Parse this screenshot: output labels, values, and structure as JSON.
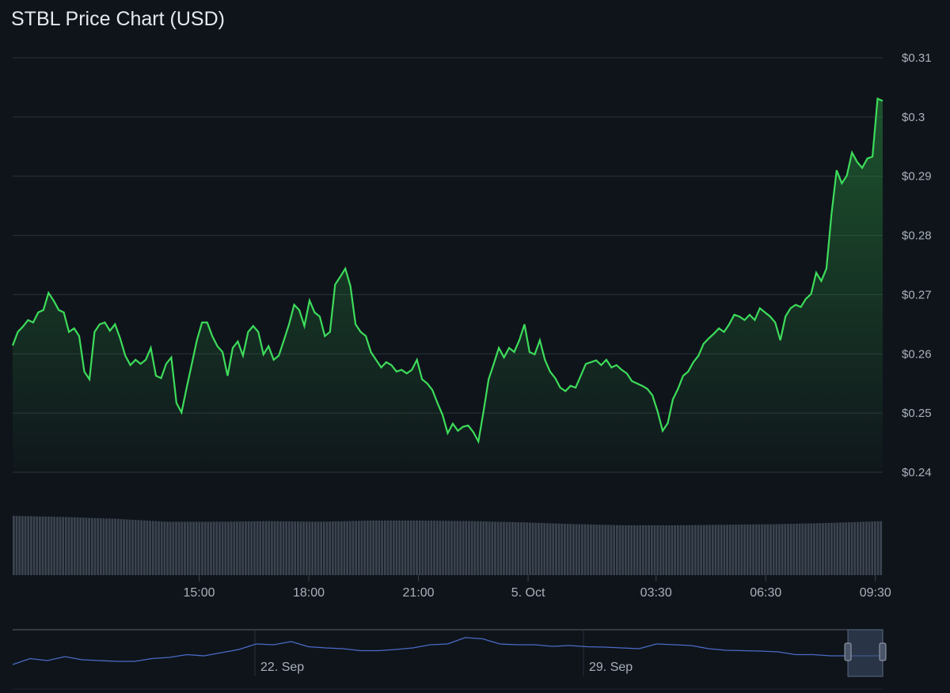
{
  "chart_data": {
    "type": "line",
    "title": "STBL Price Chart (USD)",
    "xlabel": "",
    "ylabel": "",
    "ylim": [
      0.24,
      0.31
    ],
    "y_ticks": [
      "$0.31",
      "$0.3",
      "$0.29",
      "$0.28",
      "$0.27",
      "$0.26",
      "$0.25",
      "$0.24"
    ],
    "y_tick_values": [
      0.31,
      0.3,
      0.29,
      0.28,
      0.27,
      0.26,
      0.25,
      0.24
    ],
    "x_ticks": [
      "15:00",
      "18:00",
      "21:00",
      "5. Oct",
      "03:30",
      "06:30",
      "09:30"
    ],
    "x_tick_hours": [
      15,
      18,
      21,
      24,
      27.5,
      30.5,
      33.5
    ],
    "x_range_hours": [
      9.9,
      33.7
    ],
    "grid": true,
    "series": [
      {
        "name": "STBL price",
        "color": "#3ddc5a",
        "values": [
          0.2614,
          0.2637,
          0.2646,
          0.2657,
          0.2653,
          0.267,
          0.2674,
          0.2703,
          0.269,
          0.2674,
          0.267,
          0.2637,
          0.2643,
          0.263,
          0.257,
          0.2557,
          0.2637,
          0.265,
          0.2653,
          0.2639,
          0.265,
          0.2626,
          0.2597,
          0.2581,
          0.259,
          0.2583,
          0.259,
          0.261,
          0.2563,
          0.2559,
          0.2583,
          0.2594,
          0.2517,
          0.2501,
          0.2543,
          0.2583,
          0.2623,
          0.2653,
          0.2653,
          0.263,
          0.2613,
          0.2603,
          0.2563,
          0.261,
          0.2621,
          0.2597,
          0.2637,
          0.2647,
          0.2637,
          0.2599,
          0.2613,
          0.259,
          0.2597,
          0.2623,
          0.265,
          0.2683,
          0.2674,
          0.2647,
          0.269,
          0.267,
          0.2663,
          0.263,
          0.2637,
          0.2717,
          0.273,
          0.2744,
          0.2714,
          0.265,
          0.2637,
          0.263,
          0.2603,
          0.259,
          0.2577,
          0.2586,
          0.2581,
          0.257,
          0.2573,
          0.2567,
          0.2573,
          0.259,
          0.2557,
          0.255,
          0.2539,
          0.2517,
          0.2497,
          0.2466,
          0.2482,
          0.247,
          0.2477,
          0.2479,
          0.2468,
          0.2452,
          0.2503,
          0.2557,
          0.2583,
          0.261,
          0.2594,
          0.261,
          0.2603,
          0.2623,
          0.265,
          0.2603,
          0.2599,
          0.2623,
          0.259,
          0.257,
          0.2559,
          0.2543,
          0.2537,
          0.2546,
          0.2543,
          0.2563,
          0.2583,
          0.2586,
          0.2589,
          0.2581,
          0.259,
          0.2577,
          0.2581,
          0.2573,
          0.2567,
          0.2554,
          0.255,
          0.2546,
          0.2541,
          0.253,
          0.2503,
          0.247,
          0.2483,
          0.2523,
          0.2541,
          0.2563,
          0.257,
          0.2586,
          0.2597,
          0.2617,
          0.2626,
          0.2634,
          0.2643,
          0.2637,
          0.265,
          0.2666,
          0.2663,
          0.2657,
          0.2666,
          0.2657,
          0.2677,
          0.267,
          0.2663,
          0.2653,
          0.2623,
          0.2663,
          0.2677,
          0.2683,
          0.2679,
          0.2693,
          0.2701,
          0.2737,
          0.2723,
          0.2744,
          0.2837,
          0.291,
          0.2888,
          0.2901,
          0.294,
          0.2924,
          0.2914,
          0.293,
          0.2933,
          0.3031,
          0.3027
        ]
      }
    ],
    "volume_relative": [
      1.0,
      0.98,
      0.95,
      0.9,
      0.9,
      0.91,
      0.9,
      0.92,
      0.92,
      0.91,
      0.89,
      0.86,
      0.84,
      0.84,
      0.85,
      0.86,
      0.88,
      0.91
    ],
    "navigator": {
      "x_ticks": [
        "22. Sep",
        "29. Sep"
      ],
      "series_relative": [
        0.2,
        0.35,
        0.3,
        0.4,
        0.32,
        0.3,
        0.28,
        0.28,
        0.35,
        0.38,
        0.45,
        0.42,
        0.5,
        0.58,
        0.72,
        0.7,
        0.78,
        0.65,
        0.62,
        0.6,
        0.55,
        0.55,
        0.58,
        0.62,
        0.7,
        0.72,
        0.88,
        0.85,
        0.72,
        0.7,
        0.7,
        0.66,
        0.68,
        0.65,
        0.64,
        0.62,
        0.6,
        0.72,
        0.7,
        0.68,
        0.6,
        0.56,
        0.55,
        0.54,
        0.52,
        0.45,
        0.45,
        0.42,
        0.42,
        0.42,
        0.42
      ],
      "selection_fraction": [
        0.96,
        1.0
      ]
    }
  }
}
